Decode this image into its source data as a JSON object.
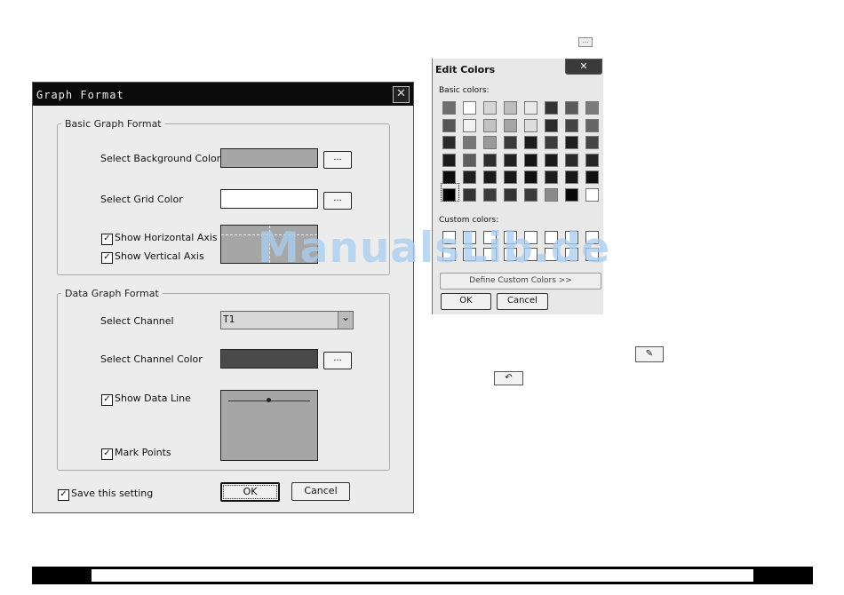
{
  "top_button": {
    "label": "..."
  },
  "graph_format": {
    "title": "Graph Format",
    "close_glyph": "✕",
    "basic": {
      "legend": "Basic Graph Format",
      "bg_color_label": "Select Background Color",
      "bg_color": "#a6a6a6",
      "grid_color_label": "Select Grid Color",
      "grid_color": "#ffffff",
      "browse_label": "...",
      "show_h_axis": "Show Horizontal Axis",
      "show_v_axis": "Show Vertical Axis",
      "check_glyph": "✓"
    },
    "data": {
      "legend": "Data Graph Format",
      "channel_label": "Select Channel",
      "channel_value": "T1",
      "dropdown_glyph": "⌄",
      "channel_color_label": "Select Channel Color",
      "channel_color": "#4a4a4a",
      "show_data_line": "Show Data Line",
      "mark_points": "Mark Points",
      "preview_bg": "#a6a6a6"
    },
    "save_setting": "Save this setting",
    "ok": "OK",
    "cancel": "Cancel"
  },
  "edit_colors": {
    "title": "Edit Colors",
    "close_glyph": "✕",
    "basic_colors_label": "Basic colors:",
    "basic_colors": [
      [
        "#6e6e6e",
        "#ffffff",
        "#d6d6d6",
        "#bdbdbd",
        "#e9e9e9",
        "#333333",
        "#5a5a5a",
        "#7a7a7a"
      ],
      [
        "#555555",
        "#f2f2f2",
        "#c2c2c2",
        "#a5a5a5",
        "#dcdcdc",
        "#2b2b2b",
        "#444444",
        "#666666"
      ],
      [
        "#2a2a2a",
        "#777777",
        "#9a9a9a",
        "#3a3a3a",
        "#1c1c1c",
        "#3c3c3c",
        "#1e1e1e",
        "#444444"
      ],
      [
        "#1d1d1d",
        "#5e5e5e",
        "#2e2e2e",
        "#222222",
        "#151515",
        "#1a1a1a",
        "#2a2a2a",
        "#252525"
      ],
      [
        "#0c0c0c",
        "#1f1f1f",
        "#1a1a1a",
        "#181818",
        "#101010",
        "#1c1c1c",
        "#181818",
        "#101010"
      ],
      [
        "#000000",
        "#333333",
        "#3b3b3b",
        "#333333",
        "#3a3a3a",
        "#8a8a8a",
        "#0a0a0a",
        "#ffffff"
      ]
    ],
    "custom_colors_label": "Custom colors:",
    "define_label": "Define Custom Colors >>",
    "ok": "OK",
    "cancel": "Cancel"
  },
  "watermark": "ManualsLib.de",
  "icon_button_1": {
    "icon": "color-picker-icon",
    "glyph": "✎"
  },
  "icon_button_2": {
    "icon": "reset-icon",
    "glyph": "↶"
  }
}
